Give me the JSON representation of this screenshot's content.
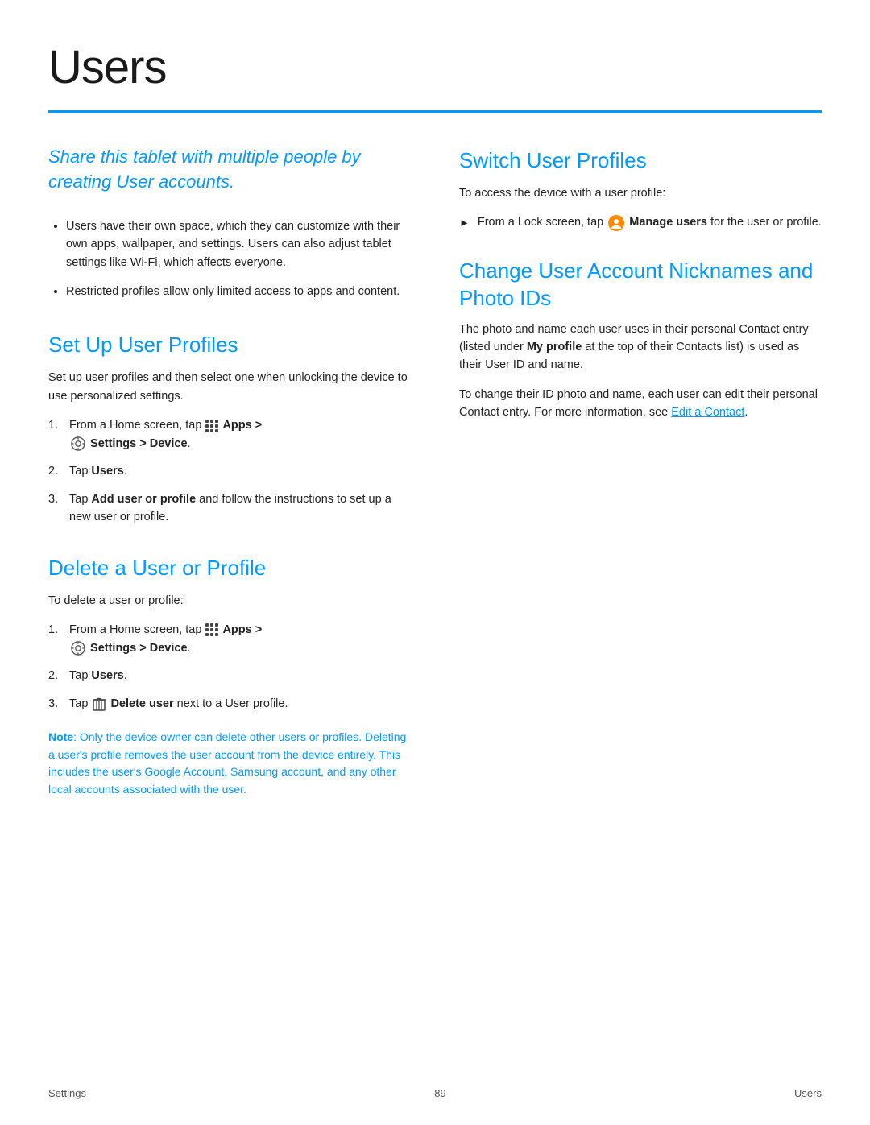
{
  "page": {
    "title": "Users",
    "divider": true,
    "footer": {
      "left": "Settings",
      "center": "89",
      "right": "Users"
    }
  },
  "left_col": {
    "intro": "Share this tablet with multiple people by creating User accounts.",
    "bullets": [
      "Users have their own space, which they can customize with their own apps, wallpaper, and settings. Users can also adjust tablet settings like Wi-Fi, which affects everyone.",
      "Restricted profiles allow only limited access to apps and content."
    ],
    "set_up_profiles": {
      "title": "Set Up User Profiles",
      "body": "Set up user profiles and then select one when unlocking the device to use personalized settings.",
      "steps": [
        {
          "num": "1.",
          "text_before": "From a Home screen, tap",
          "apps_icon": true,
          "apps_label": "Apps >",
          "settings_icon": true,
          "settings_label": "Settings > Device",
          "text_after": "."
        },
        {
          "num": "2.",
          "text": "Tap",
          "bold": "Users",
          "text_after": "."
        },
        {
          "num": "3.",
          "text_before": "Tap",
          "bold": "Add user or profile",
          "text_after": "and follow the instructions to set up a new user or profile."
        }
      ]
    },
    "delete_profile": {
      "title": "Delete a User or Profile",
      "body": "To delete a user or profile:",
      "steps": [
        {
          "num": "1.",
          "text_before": "From a Home screen, tap",
          "apps_icon": true,
          "apps_label": "Apps >",
          "settings_icon": true,
          "settings_label": "Settings > Device",
          "text_after": "."
        },
        {
          "num": "2.",
          "text": "Tap",
          "bold": "Users",
          "text_after": "."
        },
        {
          "num": "3.",
          "text_before": "Tap",
          "delete_icon": true,
          "bold": "Delete user",
          "text_after": "next to a User profile."
        }
      ],
      "note": "Note: Only the device owner can delete other users or profiles. Deleting a user's profile removes the user account from the device entirely. This includes the user's Google Account, Samsung account, and any other local accounts associated with the user."
    }
  },
  "right_col": {
    "switch_profiles": {
      "title": "Switch User Profiles",
      "body": "To access the device with a user profile:",
      "steps": [
        {
          "text_before": "From a Lock screen, tap",
          "manage_icon": true,
          "bold": "Manage users",
          "text_after": "for the user or profile."
        }
      ]
    },
    "change_account": {
      "title": "Change User Account Nicknames and Photo IDs",
      "body1": "The photo and name each user uses in their personal Contact entry (listed under My profile at the top of their Contacts list) is used as their User ID and name.",
      "body2": "To change their ID photo and name, each user can edit their personal Contact entry. For more information, see",
      "link": "Edit a Contact",
      "body2_end": "."
    }
  }
}
